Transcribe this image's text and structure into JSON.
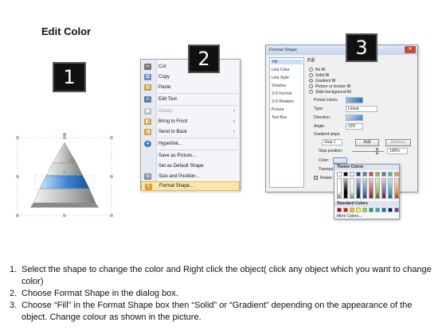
{
  "title": "Edit Color",
  "steps": [
    "1",
    "2",
    "3"
  ],
  "context_menu": {
    "items": [
      {
        "label": "Cut",
        "icon": "cut-icon",
        "underline": "t"
      },
      {
        "label": "Copy",
        "icon": "copy-icon"
      },
      {
        "label": "Paste",
        "icon": "paste-icon"
      },
      {
        "label": "Edit Text",
        "icon": "edit-text-icon"
      },
      {
        "label": "Group",
        "icon": "group-icon",
        "disabled": true,
        "submenu": true
      },
      {
        "label": "Bring to Front",
        "icon": "bring-to-front-icon",
        "submenu": true
      },
      {
        "label": "Send to Back",
        "icon": "send-to-back-icon",
        "submenu": true
      },
      {
        "label": "Hyperlink...",
        "icon": "hyperlink-icon"
      },
      {
        "label": "Save as Picture...",
        "icon": ""
      },
      {
        "label": "Set as Default Shape",
        "icon": ""
      },
      {
        "label": "Size and Position...",
        "icon": "size-position-icon"
      },
      {
        "label": "Format Shape...",
        "icon": "format-shape-icon",
        "selected": true
      }
    ]
  },
  "format_dialog": {
    "title": "Format Shape",
    "categories": [
      "Fill",
      "Line Color",
      "Line Style",
      "Shadow",
      "3-D Format",
      "3-D Rotation",
      "Picture",
      "Text Box"
    ],
    "selected_category": "Fill",
    "section_title": "Fill",
    "fill_options": [
      "No fill",
      "Solid fill",
      "Gradient fill",
      "Picture or texture fill",
      "Slide background fill"
    ],
    "selected_fill": "Gradient fill",
    "preset_colors_label": "Preset colors:",
    "type_label": "Type:",
    "type_value": "Linear",
    "direction_label": "Direction:",
    "angle_label": "Angle:",
    "angle_value": "225°",
    "gradient_stops_label": "Gradient stops",
    "stop_value": "Stop 1",
    "add_label": "Add",
    "remove_label": "Remove",
    "stop_position_label": "Stop position:",
    "stop_position_value": "100%",
    "color_label": "Color:",
    "transparency_label": "Transpa",
    "rotate_label": "Rotate"
  },
  "palette": {
    "theme_title": "Theme Colors",
    "standard_title": "Standard Colors",
    "more_colors": "More Colors...",
    "theme_colors": [
      "#ffffff",
      "#000000",
      "#eeece1",
      "#1f497d",
      "#4f81bd",
      "#c0504d",
      "#9bbb59",
      "#8064a2",
      "#4bacc6",
      "#f79646"
    ],
    "standard_colors": [
      "#c00000",
      "#ff0000",
      "#ffc000",
      "#ffff00",
      "#92d050",
      "#00b050",
      "#00b0f0",
      "#0070c0",
      "#002060",
      "#7030a0"
    ]
  },
  "instructions": [
    {
      "num": "1.",
      "text": "Select the shape to change the color and Right click the object( click any object which you want to change color)"
    },
    {
      "num": "2.",
      "text": "Choose Format Shape in the dialog box."
    },
    {
      "num": "3.",
      "text": "Choose “Fill” in the Format Shape box then “Solid” or “Gradient” depending on the appearance of the object. Change colour as shown in the picture."
    }
  ]
}
